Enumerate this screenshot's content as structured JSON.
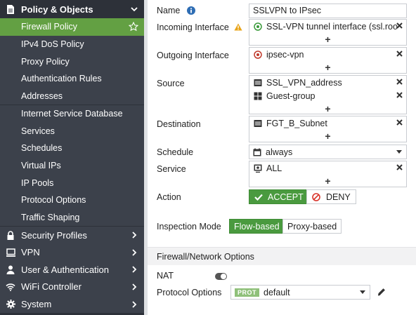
{
  "sidebar": {
    "top_section": {
      "label": "Policy & Objects",
      "icon": "doc-icon"
    },
    "items": [
      {
        "label": "Firewall Policy",
        "active": true
      },
      {
        "label": "IPv4 DoS Policy"
      },
      {
        "label": "Proxy Policy"
      },
      {
        "label": "Authentication Rules"
      },
      {
        "label": "Addresses"
      },
      {
        "label": "Internet Service Database"
      },
      {
        "label": "Services"
      },
      {
        "label": "Schedules"
      },
      {
        "label": "Virtual IPs"
      },
      {
        "label": "IP Pools"
      },
      {
        "label": "Protocol Options"
      },
      {
        "label": "Traffic Shaping"
      }
    ],
    "sections": [
      {
        "label": "Security Profiles",
        "icon": "lock-icon"
      },
      {
        "label": "VPN",
        "icon": "monitor-icon"
      },
      {
        "label": "User & Authentication",
        "icon": "user-icon"
      },
      {
        "label": "WiFi Controller",
        "icon": "wifi-icon"
      },
      {
        "label": "System",
        "icon": "gear-icon"
      }
    ]
  },
  "form": {
    "name": {
      "label": "Name",
      "value": "SSLVPN to IPsec"
    },
    "incoming": {
      "label": "Incoming Interface",
      "entries": [
        "SSL-VPN tunnel interface (ssl.roo"
      ]
    },
    "outgoing": {
      "label": "Outgoing Interface",
      "entries": [
        "ipsec-vpn"
      ]
    },
    "source": {
      "label": "Source",
      "entries": [
        "SSL_VPN_address",
        "Guest-group"
      ]
    },
    "destination": {
      "label": "Destination",
      "entries": [
        "FGT_B_Subnet"
      ]
    },
    "schedule": {
      "label": "Schedule",
      "value": "always"
    },
    "service": {
      "label": "Service",
      "entries": [
        "ALL"
      ]
    },
    "action": {
      "label": "Action",
      "accept": "ACCEPT",
      "deny": "DENY",
      "selected": "ACCEPT"
    },
    "inspection": {
      "label": "Inspection Mode",
      "flow": "Flow-based",
      "proxy": "Proxy-based",
      "selected": "Flow-based"
    },
    "plus": "+"
  },
  "options": {
    "header": "Firewall/Network Options",
    "nat": {
      "label": "NAT",
      "enabled": false
    },
    "protocol": {
      "label": "Protocol Options",
      "badge": "PROT",
      "value": "default"
    }
  },
  "colors": {
    "sidebar_bg": "#2d3139",
    "section_bg": "#3c414b",
    "active_green": "#63a043",
    "accept_green": "#4a9a3f"
  }
}
